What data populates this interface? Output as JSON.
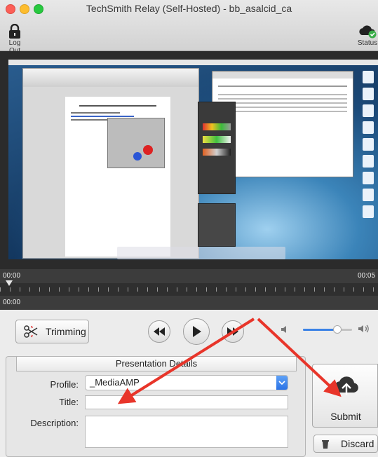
{
  "window": {
    "title": "TechSmith Relay (Self-Hosted) - bb_asalcid_ca"
  },
  "toolbar": {
    "logout_label": "Log Out",
    "status_label": "Status"
  },
  "timeline": {
    "start_time": "00:00",
    "end_time": "00:05",
    "current_time": "00:00"
  },
  "playback": {
    "trimming_label": "Trimming",
    "volume_level": 0.7
  },
  "presentation": {
    "header": "Presentation Details",
    "profile_label": "Profile:",
    "profile_value": "_MediaAMP",
    "title_label": "Title:",
    "title_value": "",
    "description_label": "Description:",
    "description_value": ""
  },
  "actions": {
    "submit_label": "Submit",
    "discard_label": "Discard"
  },
  "colors": {
    "annotation_arrow": "#e8352a",
    "accent": "#3b82e6"
  }
}
